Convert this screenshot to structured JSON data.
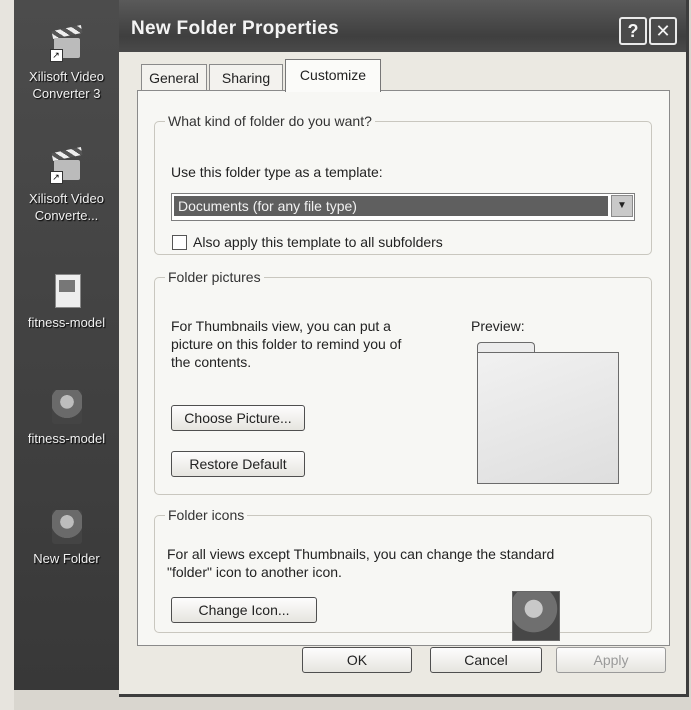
{
  "desktop": {
    "icons": [
      {
        "label_line1": "Xilisoft Video",
        "label_line2": "Converter 3"
      },
      {
        "label_line1": "Xilisoft Video",
        "label_line2": "Converte..."
      },
      {
        "label_line1": "fitness-model",
        "label_line2": ""
      },
      {
        "label_line1": "fitness-model",
        "label_line2": ""
      },
      {
        "label_line1": "New Folder",
        "label_line2": ""
      }
    ]
  },
  "window": {
    "title": "New Folder Properties",
    "help_glyph": "?",
    "close_glyph": "✕"
  },
  "tabs": [
    {
      "label": "General",
      "active": false
    },
    {
      "label": "Sharing",
      "active": false
    },
    {
      "label": "Customize",
      "active": true
    }
  ],
  "folder_type": {
    "group_label": "What kind of folder do you want?",
    "template_label": "Use this folder type as a template:",
    "selected_template": "Documents (for any file type)",
    "apply_subfolders_label": "Also apply this template to all subfolders",
    "apply_subfolders_checked": false
  },
  "folder_pictures": {
    "group_label": "Folder pictures",
    "description_line1": "For Thumbnails view, you can put a",
    "description_line2": "picture on this folder to remind you of",
    "description_line3": "the contents.",
    "preview_label": "Preview:",
    "choose_button": "Choose Picture...",
    "restore_button": "Restore Default"
  },
  "folder_icons": {
    "group_label": "Folder icons",
    "description_line1": "For all views except Thumbnails, you can change the standard",
    "description_line2": "\"folder\" icon to another icon.",
    "change_button": "Change Icon..."
  },
  "footer": {
    "ok": "OK",
    "cancel": "Cancel",
    "apply": "Apply"
  },
  "colors": {
    "desktop_background": "#3f3f3f",
    "title_bar": "#4a4a4a",
    "dialog_background": "#ebe9e2",
    "selected_combo": "#5f5f5f"
  }
}
